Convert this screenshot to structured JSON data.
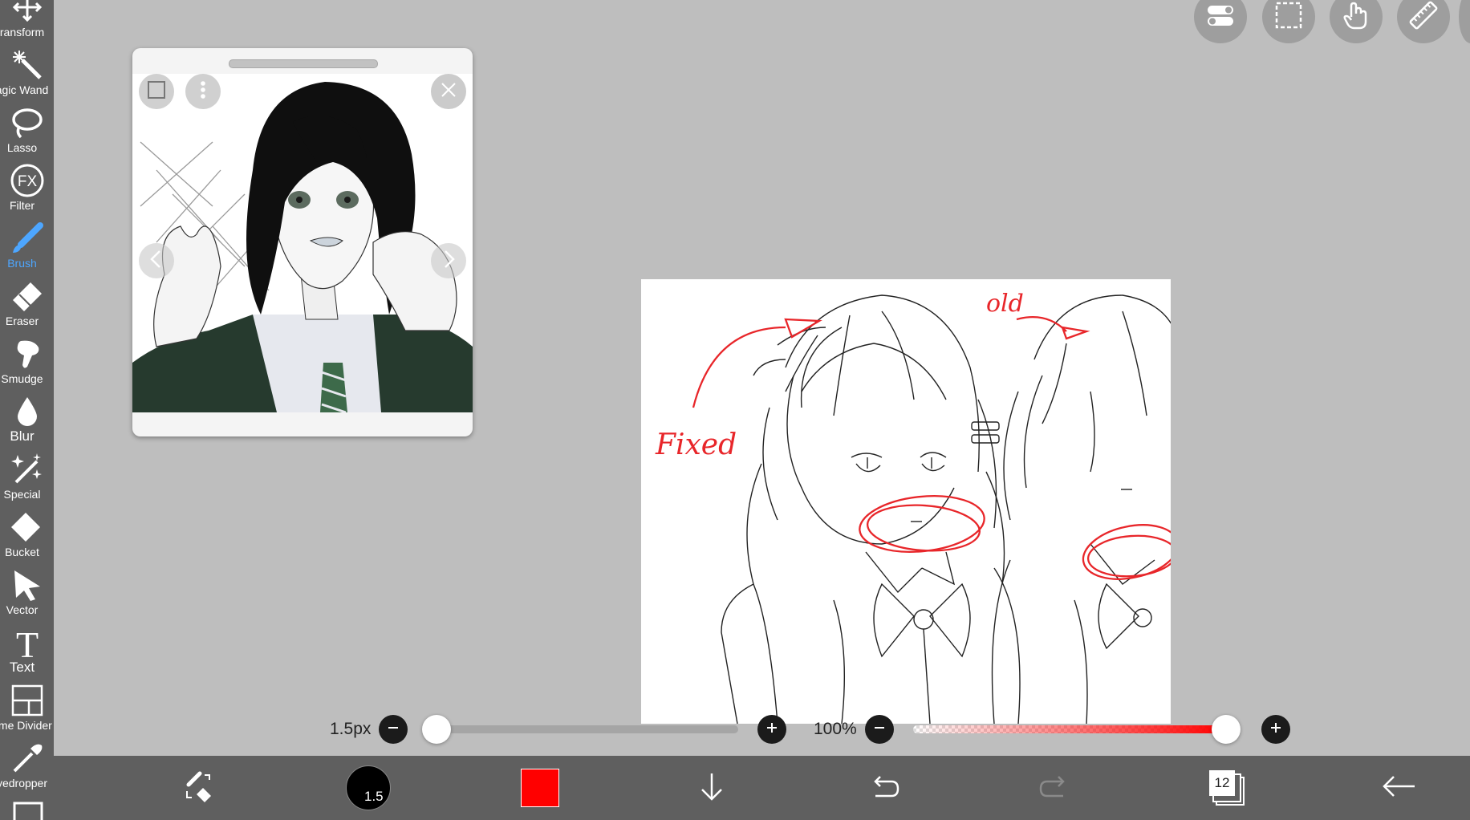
{
  "sidebar": {
    "items": [
      {
        "label": "ransform",
        "icon": "transform-icon",
        "active": false
      },
      {
        "label": "agic Wand",
        "icon": "magic-wand-icon",
        "active": false
      },
      {
        "label": "Lasso",
        "icon": "lasso-icon",
        "active": false
      },
      {
        "label": "Filter",
        "icon": "fx-filter-icon",
        "active": false
      },
      {
        "label": "Brush",
        "icon": "brush-icon",
        "active": true
      },
      {
        "label": "Eraser",
        "icon": "eraser-icon",
        "active": false
      },
      {
        "label": "Smudge",
        "icon": "smudge-icon",
        "active": false
      },
      {
        "label": "Blur",
        "icon": "blur-drop-icon",
        "active": false
      },
      {
        "label": "Special",
        "icon": "special-wand-icon",
        "active": false
      },
      {
        "label": "Bucket",
        "icon": "bucket-icon",
        "active": false
      },
      {
        "label": "Vector",
        "icon": "vector-arrow-icon",
        "active": false
      },
      {
        "label": "Text",
        "icon": "text-icon",
        "active": false
      },
      {
        "label": "ame Divider",
        "icon": "frame-divider-icon",
        "active": false
      },
      {
        "label": "yedropper",
        "icon": "eyedropper-icon",
        "active": false
      }
    ]
  },
  "top_buttons": [
    {
      "icon": "toggle-settings-icon"
    },
    {
      "icon": "selection-icon"
    },
    {
      "icon": "hand-gesture-icon"
    },
    {
      "icon": "ruler-icon"
    }
  ],
  "reference_window": {
    "image_description_icon": "anime-character-reference-image"
  },
  "canvas_annotations": {
    "fixed_label": "Fixed",
    "old_label": "old"
  },
  "brush_size": {
    "label": "1.5px",
    "value_fraction": 0.03
  },
  "opacity": {
    "label": "100%",
    "value_fraction": 1.0
  },
  "bottom_bar": {
    "brush_size_badge": "1.5",
    "color": "#ff0000",
    "layer_count": "12"
  },
  "colors": {
    "accent": "#4da6ff",
    "toolbar_bg": "#5f5f5f",
    "workspace_bg": "#bebebe",
    "annotation_red": "#e8262a"
  }
}
